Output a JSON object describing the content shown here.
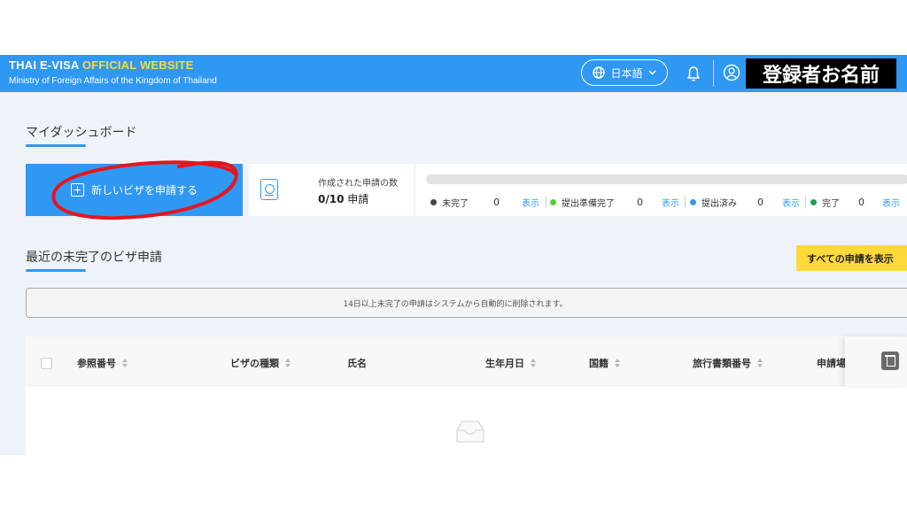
{
  "header": {
    "brand_part1": "THAI E-VISA",
    "brand_part2": "OFFICIAL WEBSITE",
    "subtitle": "Ministry of Foreign Affairs of the Kingdom of Thailand",
    "language": "日本語",
    "user_name": "登録者お名前",
    "icons": [
      "globe-icon",
      "chevron-down-icon",
      "bell-icon",
      "user-icon"
    ]
  },
  "dashboard": {
    "title": "マイダッシュボード",
    "new_visa_label": "新しいビザを申請する",
    "applications_label": "作成された申請の数",
    "applications_count": "0/10",
    "applications_unit": " 申請",
    "progress_fraction": 0,
    "statuses": [
      {
        "label": "未完了",
        "count": "0",
        "link": "表示",
        "color": "#444444"
      },
      {
        "label": "提出準備完了",
        "count": "0",
        "link": "表示",
        "color": "#5fcb3c"
      },
      {
        "label": "提出済み",
        "count": "0",
        "link": "表示",
        "color": "#2f98f3"
      },
      {
        "label": "完了",
        "count": "0",
        "link": "表示",
        "color": "#1f9d55"
      }
    ]
  },
  "recent": {
    "title": "最近の未完了のビザ申請",
    "show_all_label": "すべての申請を表示",
    "notice": "14日以上未完了の申請はシステムから自動的に削除されます。"
  },
  "table": {
    "columns": [
      "参照番号",
      "ビザの種類",
      "氏名",
      "生年月日",
      "国籍",
      "旅行書類番号",
      "申請場"
    ],
    "rows": []
  },
  "colors": {
    "primary": "#2f98f3",
    "accent": "#ffd83a",
    "annotation": "#e4161c"
  }
}
